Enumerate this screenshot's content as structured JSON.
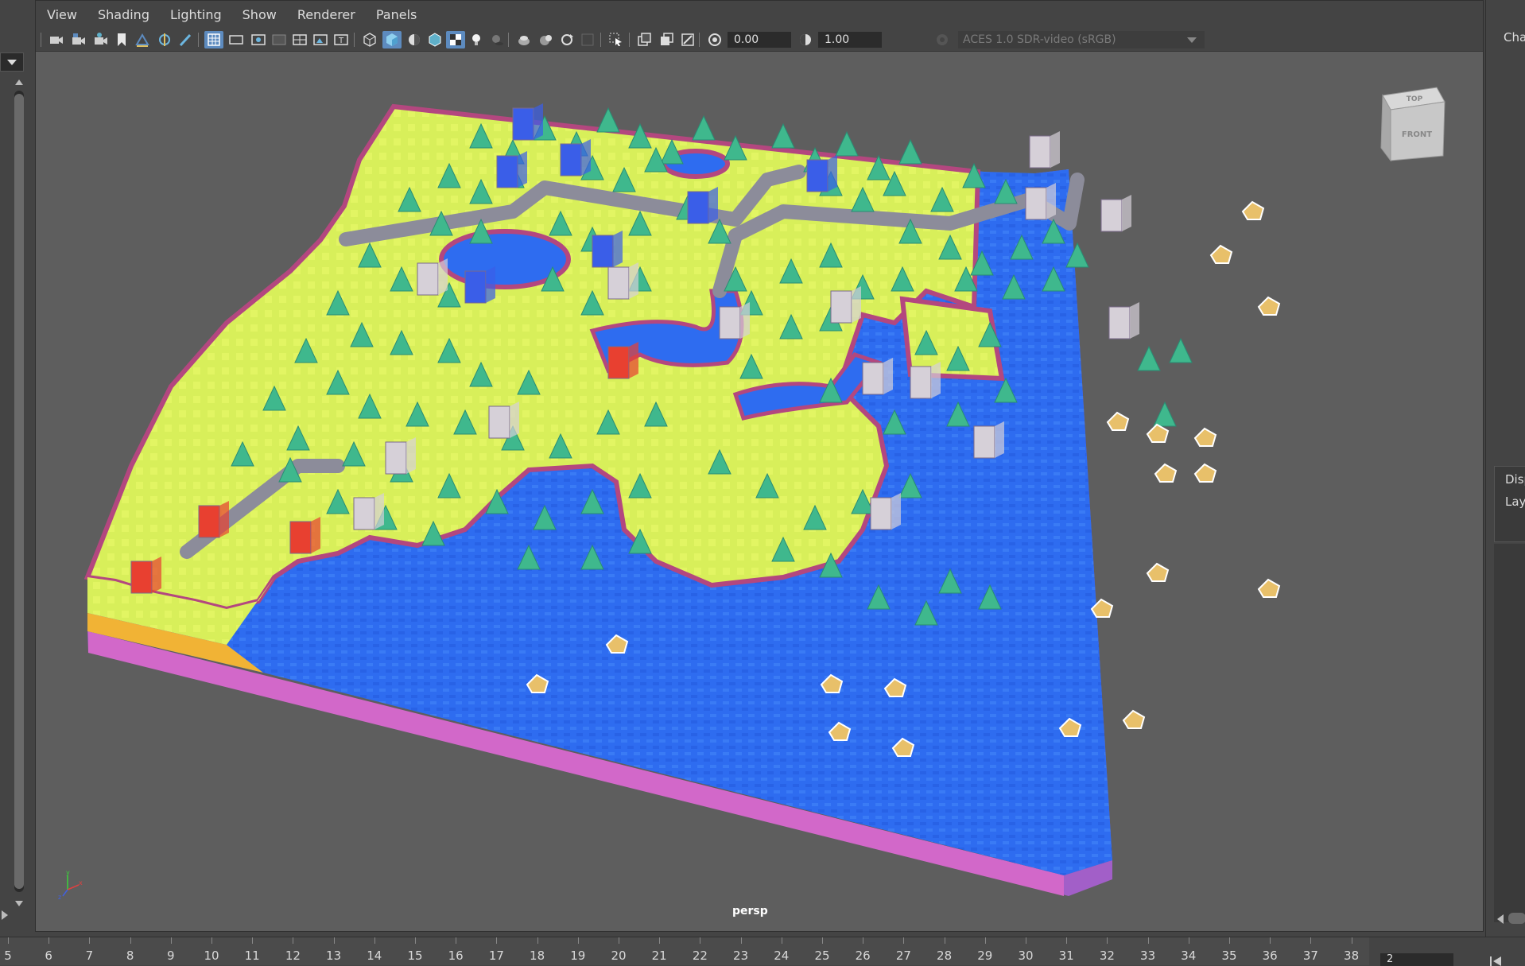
{
  "menubar": {
    "items": [
      "View",
      "Shading",
      "Lighting",
      "Show",
      "Renderer",
      "Panels"
    ]
  },
  "toolbar": {
    "exposure_value": "0.00",
    "gamma_value": "1.00",
    "color_space": "ACES 1.0 SDR-video (sRGB)"
  },
  "viewport": {
    "camera_label": "persp",
    "viewcube_top": "TOP",
    "viewcube_front": "FRONT",
    "accent_color": "#5d8bbf"
  },
  "right_panel": {
    "channel_box_label": "Char",
    "display_label": "Disp",
    "layer_label": "Laye"
  },
  "timeline": {
    "ticks": [
      "5",
      "6",
      "7",
      "8",
      "9",
      "10",
      "11",
      "12",
      "13",
      "14",
      "15",
      "16",
      "17",
      "18",
      "19",
      "20",
      "21",
      "22",
      "23",
      "24",
      "25",
      "26",
      "27",
      "28",
      "29",
      "30",
      "31",
      "32",
      "33",
      "34",
      "35",
      "36",
      "37",
      "38"
    ],
    "current_frame_field": "2"
  },
  "icons": {
    "toolbar": [
      "camera-icon",
      "camera-lock-icon",
      "camera-attr-icon",
      "bookmark-icon",
      "image-plane-icon",
      "2d-pan-icon",
      "grease-pencil-icon",
      "grid-icon",
      "film-gate-icon",
      "resolution-gate-icon",
      "gate-mask-icon",
      "field-chart-icon",
      "safe-action-icon",
      "safe-title-icon",
      "wireframe-icon",
      "smooth-shade-icon",
      "use-lights-icon",
      "wireframe-on-shaded-icon",
      "textured-icon",
      "use-all-lights-icon",
      "shadows-icon",
      "xray-icon",
      "xray-active-icon",
      "xray-joints-icon",
      "isolate-icon",
      "select-icon",
      "hud-icon",
      "motion-blur-icon",
      "aa-icon",
      "exposure-icon",
      "gamma-icon",
      "color-mgmt-icon"
    ]
  }
}
